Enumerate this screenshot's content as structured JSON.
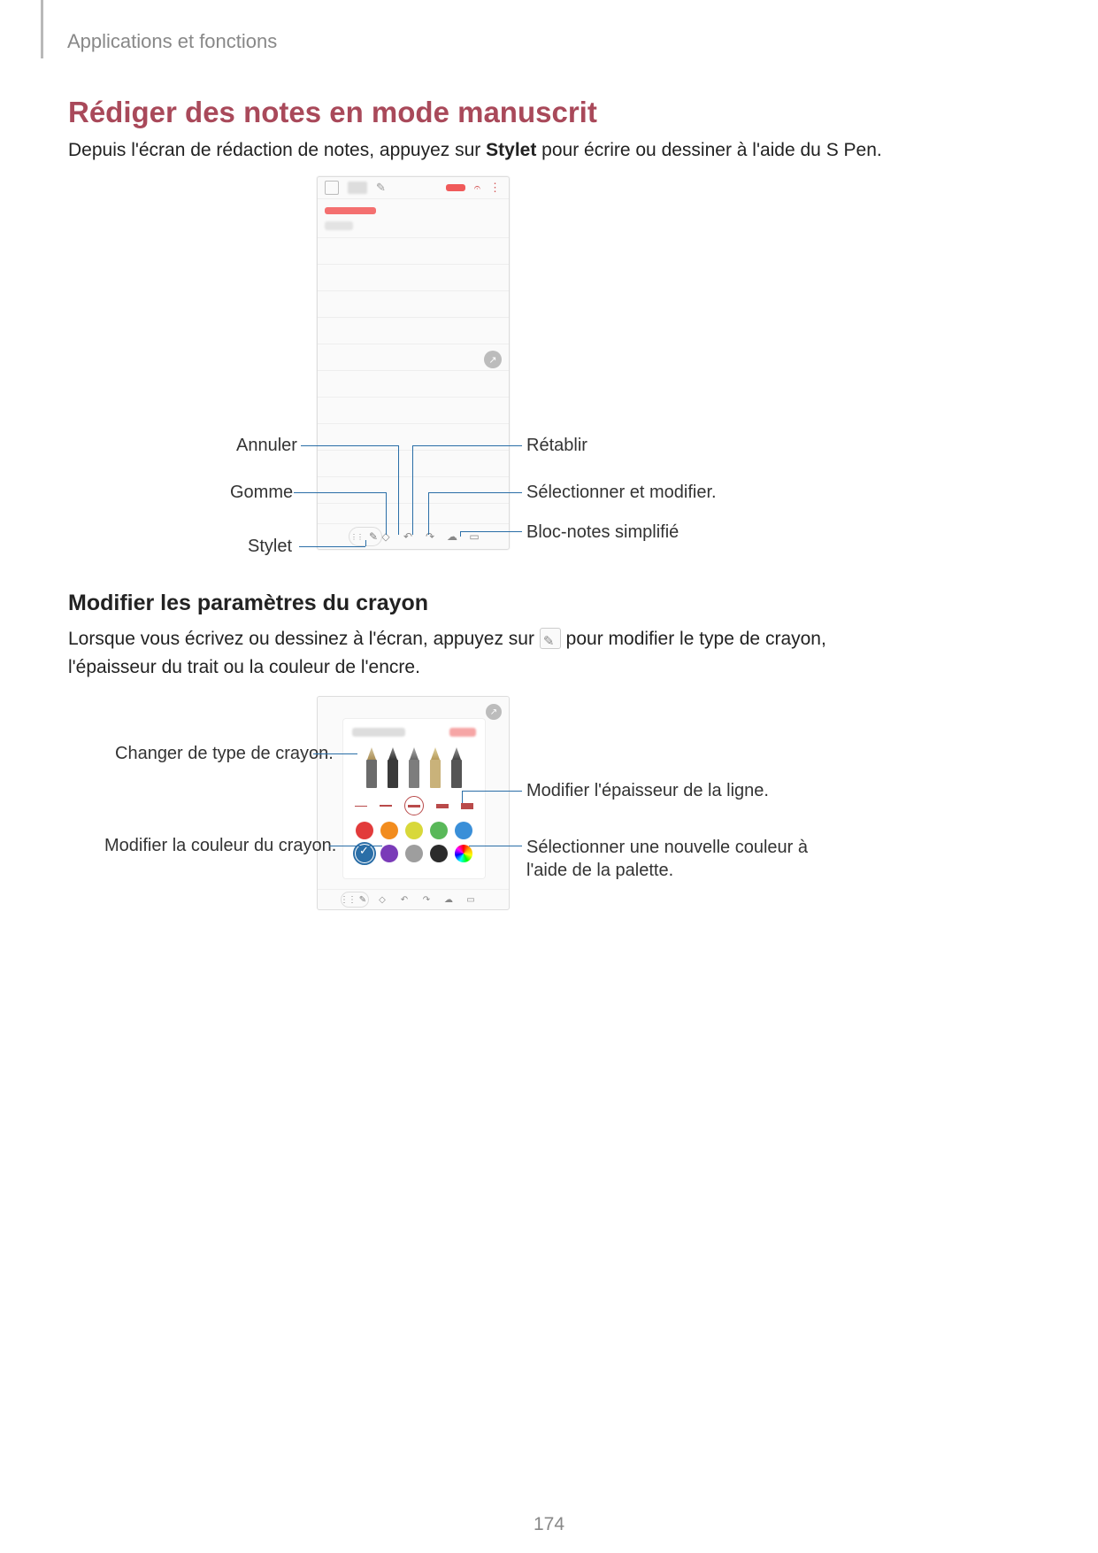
{
  "header": "Applications et fonctions",
  "h1": "Rédiger des notes en mode manuscrit",
  "p1_a": "Depuis l'écran de rédaction de notes, appuyez sur ",
  "p1_bold": "Stylet",
  "p1_b": " pour écrire ou dessiner à l'aide du S Pen.",
  "callouts1": {
    "annuler": "Annuler",
    "gomme": "Gomme",
    "stylet": "Stylet",
    "retablir": "Rétablir",
    "select": "Sélectionner et modifier.",
    "bloc": "Bloc-notes simplifié"
  },
  "h2": "Modifier les paramètres du crayon",
  "p2_a": "Lorsque vous écrivez ou dessinez à l'écran, appuyez sur ",
  "p2_b": " pour modifier le type de crayon, l'épaisseur du trait ou la couleur de l'encre.",
  "callouts2": {
    "type": "Changer de type de crayon.",
    "couleur": "Modifier la couleur du crayon.",
    "epaisseur": "Modifier l'épaisseur de la ligne.",
    "palette": "Sélectionner une nouvelle couleur à l'aide de la palette."
  },
  "pen_colors_row1": [
    "#e23b3b",
    "#f28c1e",
    "#d8d83a",
    "#59b859",
    "#3a8fd8"
  ],
  "pen_colors_row2": [
    "#2a6ea7",
    "#7a3bb8",
    "#9e9e9e",
    "#2b2b2b",
    "rainbow"
  ],
  "selected_color_index": 5,
  "page_number": "174"
}
